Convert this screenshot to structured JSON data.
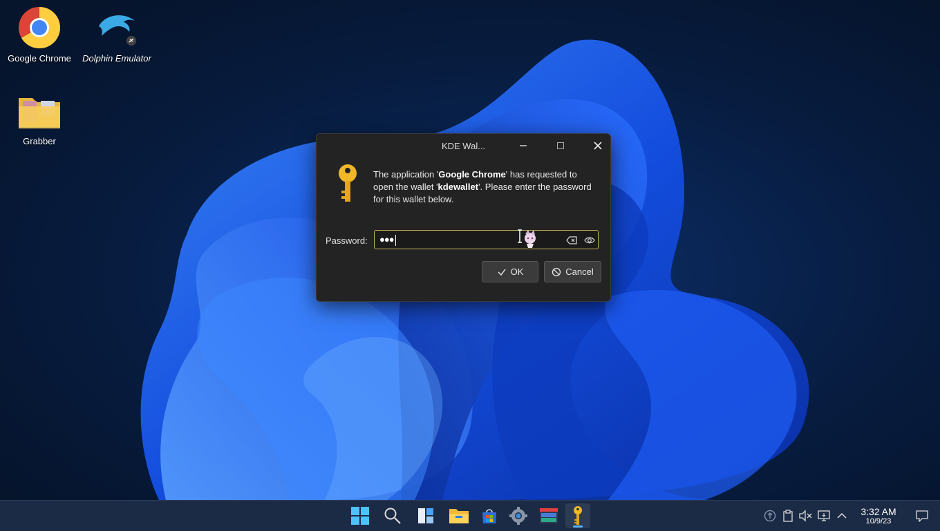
{
  "desktop": {
    "icons": [
      {
        "label": "Google Chrome"
      },
      {
        "label": "Dolphin Emulator"
      },
      {
        "label": "Grabber"
      }
    ]
  },
  "dialog": {
    "title": "KDE Wal...",
    "message_part1": "The application '",
    "app_name": "Google Chrome",
    "message_part2": "' has requested to open the wallet '",
    "wallet_name": "kdewallet",
    "message_part3": "'. Please enter the password for this wallet below.",
    "password_label": "Password:",
    "password_value": "●●●",
    "ok_label": "OK",
    "cancel_label": "Cancel"
  },
  "taskbar": {
    "apps": [
      "start-menu",
      "search",
      "widgets",
      "file-explorer",
      "microsoft-store",
      "settings",
      "app-window",
      "kde-wallet"
    ],
    "time": "3:32 AM",
    "date": "10/9/23"
  },
  "colors": {
    "accent": "#c8b85a",
    "taskbar": "#1c2b45",
    "dialog_bg": "#232323"
  }
}
